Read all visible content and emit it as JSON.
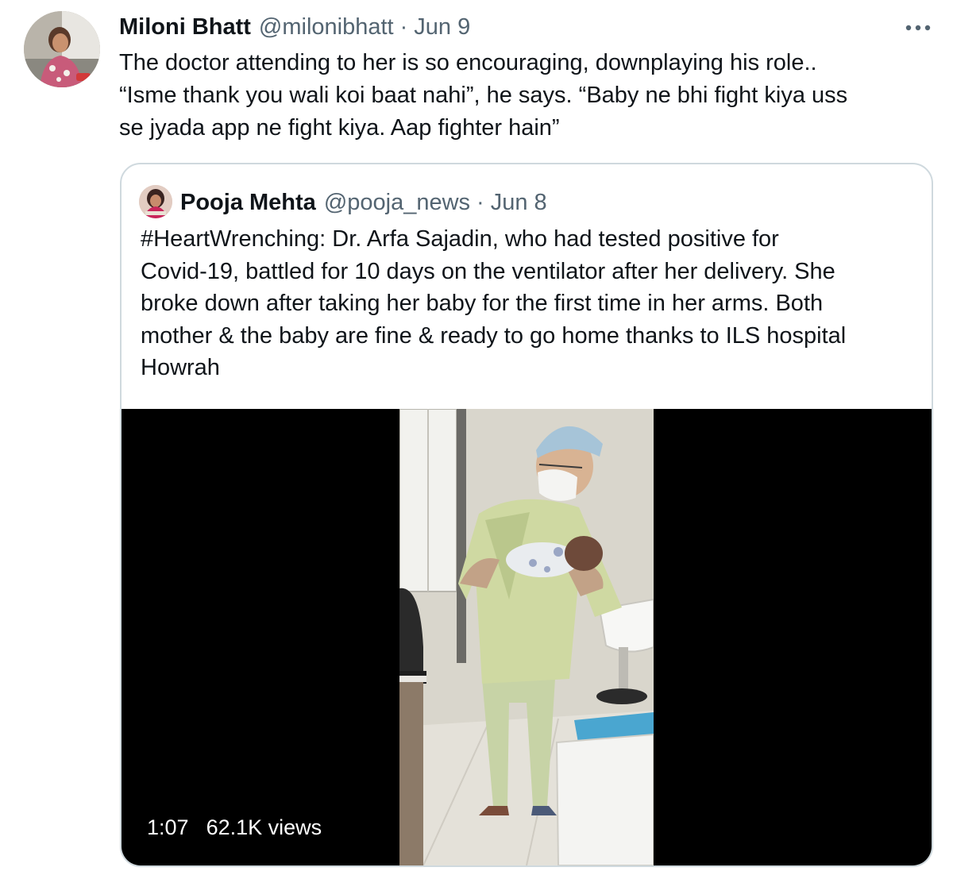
{
  "tweet": {
    "author": {
      "name": "Miloni Bhatt",
      "handle": "@milonibhatt",
      "separator": "·",
      "date": "Jun 9"
    },
    "more_icon": "more-horizontal-icon",
    "text": "The doctor attending to her is so encouraging, downplaying his role..\n“Isme thank you wali koi baat nahi”, he says. “Baby ne bhi fight kiya uss\nse jyada app ne fight kiya. Aap fighter hain”"
  },
  "quoted_tweet": {
    "author": {
      "name": "Pooja Mehta",
      "handle": "@pooja_news",
      "separator": "·",
      "date": "Jun 8"
    },
    "text": "#HeartWrenching: Dr. Arfa Sajadin, who had tested positive for\nCovid-19, battled for 10 days on the ventilator after her delivery. She\nbroke down after taking her baby for the first time in her arms. Both\nmother & the baby are fine & ready to go home thanks to ILS hospital\nHowrah",
    "video": {
      "duration": "1:07",
      "views": "62.1K views"
    }
  },
  "colors": {
    "text_primary": "#0f1419",
    "text_secondary": "#536471",
    "border": "#cfd9de",
    "video_background": "#000000"
  }
}
